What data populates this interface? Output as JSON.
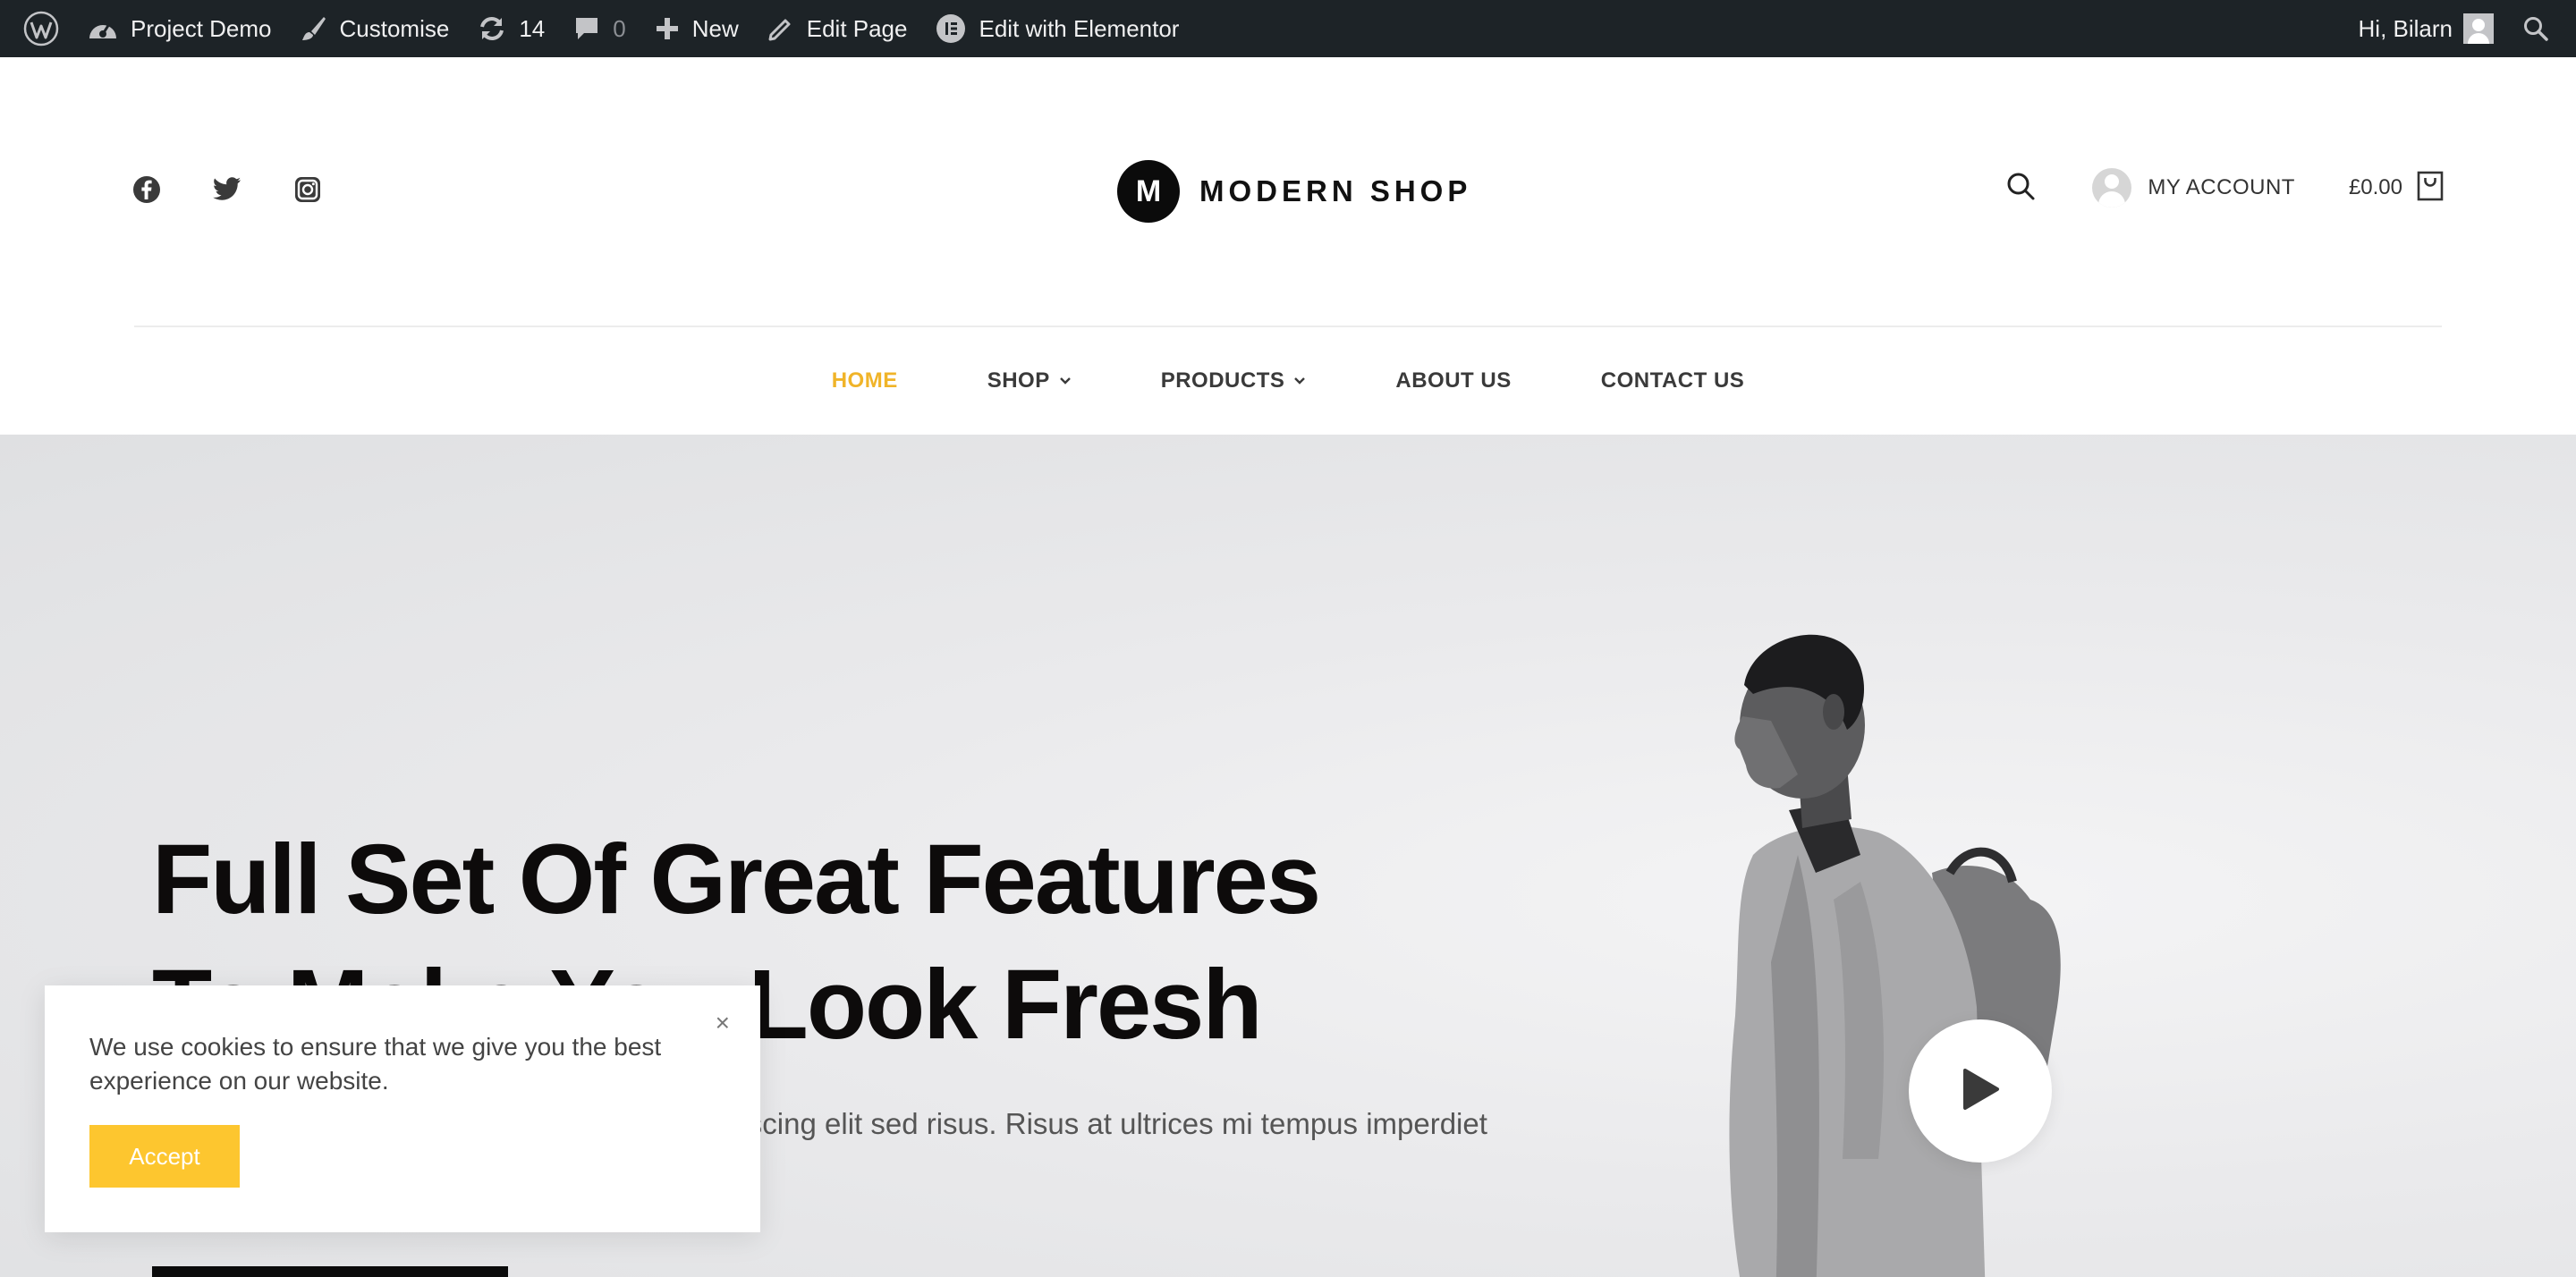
{
  "admin_bar": {
    "wp_logo_icon": "wordpress-icon",
    "site_name": "Project Demo",
    "customise": "Customise",
    "updates_count": "14",
    "comments_count": "0",
    "new_label": "New",
    "edit_page": "Edit Page",
    "edit_elementor": "Edit with Elementor",
    "greeting": "Hi, Bilarn"
  },
  "header": {
    "social_icons": [
      "facebook-icon",
      "twitter-icon",
      "instagram-icon"
    ],
    "logo_letter": "M",
    "logo_text": "MODERN SHOP",
    "account_label": "MY ACCOUNT",
    "cart_total": "£0.00"
  },
  "nav": {
    "items": [
      {
        "label": "HOME",
        "active": true,
        "dropdown": false
      },
      {
        "label": "SHOP",
        "active": false,
        "dropdown": true
      },
      {
        "label": "PRODUCTS",
        "active": false,
        "dropdown": true
      },
      {
        "label": "ABOUT US",
        "active": false,
        "dropdown": false
      },
      {
        "label": "CONTACT US",
        "active": false,
        "dropdown": false
      }
    ],
    "active_color": "#f0b429"
  },
  "hero": {
    "title_line1": "Full Set Of Great Features",
    "title_line2": "To Make You Look Fresh",
    "text": "Lorem ipsum dolor sit amet, consectetur adipiscing elit sed risus. Risus at ultrices mi tempus imperdiet nulla"
  },
  "cookie": {
    "message": "We use cookies to ensure that we give you the best experience on our website.",
    "close": "×",
    "accept": "Accept",
    "accent": "#fdc62f"
  }
}
